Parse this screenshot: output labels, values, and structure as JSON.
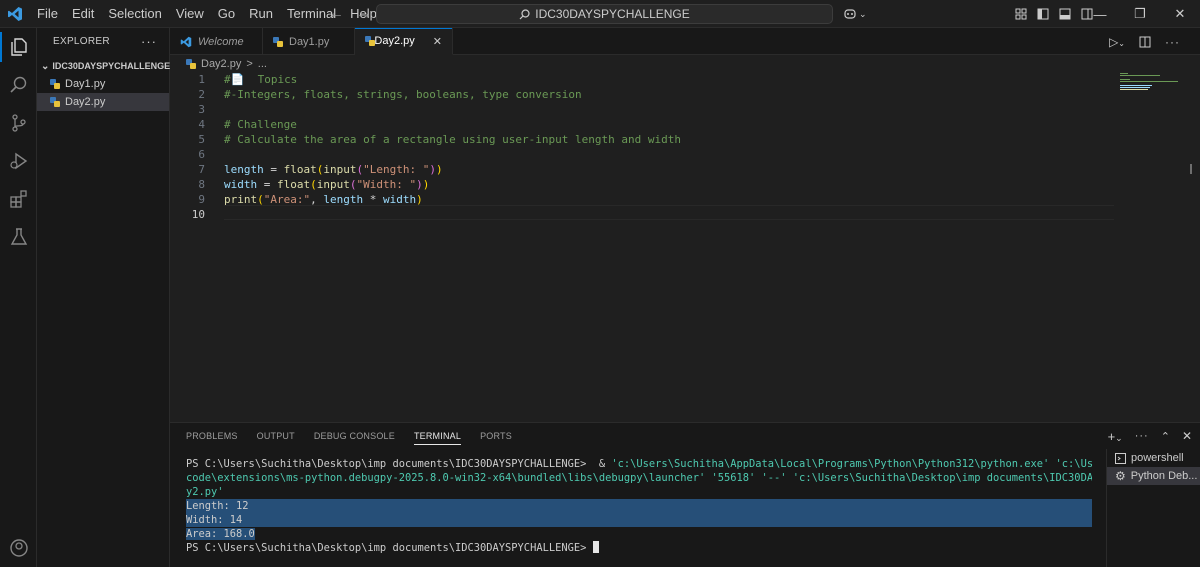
{
  "menu": [
    "File",
    "Edit",
    "Selection",
    "View",
    "Go",
    "Run",
    "Terminal",
    "Help"
  ],
  "command_center": "IDC30DAYSPYCHALLENGE",
  "sidebar": {
    "title": "EXPLORER",
    "folder": "IDC30DAYSPYCHALLENGE",
    "files": [
      {
        "name": "Day1.py"
      },
      {
        "name": "Day2.py"
      }
    ]
  },
  "tabs": [
    {
      "label": "Welcome"
    },
    {
      "label": "Day1.py"
    },
    {
      "label": "Day2.py"
    }
  ],
  "breadcrumb": {
    "file": "Day2.py",
    "sep": ">",
    "rest": "..."
  },
  "editor": {
    "lines": [
      {
        "n": "1",
        "parts": [
          [
            "c-com",
            "#"
          ],
          [
            "c-op",
            "📄"
          ],
          [
            "c-com",
            "  Topics"
          ]
        ]
      },
      {
        "n": "2",
        "parts": [
          [
            "c-com",
            "#-Integers, floats, strings, booleans, type conversion"
          ]
        ]
      },
      {
        "n": "3",
        "parts": []
      },
      {
        "n": "4",
        "parts": [
          [
            "c-com",
            "# Challenge"
          ]
        ]
      },
      {
        "n": "5",
        "parts": [
          [
            "c-com",
            "# Calculate the area of a rectangle using user-input length and width"
          ]
        ]
      },
      {
        "n": "6",
        "parts": []
      },
      {
        "n": "7",
        "parts": [
          [
            "c-var",
            "length"
          ],
          [
            "c-op",
            " = "
          ],
          [
            "c-fn",
            "float"
          ],
          [
            "c-p1",
            "("
          ],
          [
            "c-fn",
            "input"
          ],
          [
            "c-p2",
            "("
          ],
          [
            "c-str",
            "\"Length: \""
          ],
          [
            "c-p2",
            ")"
          ],
          [
            "c-p1",
            ")"
          ]
        ]
      },
      {
        "n": "8",
        "parts": [
          [
            "c-var",
            "width"
          ],
          [
            "c-op",
            " = "
          ],
          [
            "c-fn",
            "float"
          ],
          [
            "c-p1",
            "("
          ],
          [
            "c-fn",
            "input"
          ],
          [
            "c-p2",
            "("
          ],
          [
            "c-str",
            "\"Width: \""
          ],
          [
            "c-p2",
            ")"
          ],
          [
            "c-p1",
            ")"
          ]
        ]
      },
      {
        "n": "9",
        "parts": [
          [
            "c-fn",
            "print"
          ],
          [
            "c-p1",
            "("
          ],
          [
            "c-str",
            "\"Area:\""
          ],
          [
            "c-op",
            ", "
          ],
          [
            "c-var",
            "length"
          ],
          [
            "c-op",
            " * "
          ],
          [
            "c-var",
            "width"
          ],
          [
            "c-p1",
            ")"
          ]
        ]
      },
      {
        "n": "10",
        "parts": []
      }
    ]
  },
  "panel": {
    "tabs": [
      "PROBLEMS",
      "OUTPUT",
      "DEBUG CONSOLE",
      "TERMINAL",
      "PORTS"
    ],
    "active_tab": "TERMINAL",
    "terminal": {
      "cmd_prompt": "PS C:\\Users\\Suchitha\\Desktop\\imp documents\\IDC30DAYSPYCHALLENGE>  & ",
      "cmd_line1_rest": "'c:\\Users\\Suchitha\\AppData\\Local\\Programs\\Python\\Python312\\python.exe' 'c:\\Users\\Suchitha\\.vs",
      "cmd_line2": "code\\extensions\\ms-python.debugpy-2025.8.0-win32-x64\\bundled\\libs\\debugpy\\launcher' '55618' '--' 'c:\\Users\\Suchitha\\Desktop\\imp documents\\IDC30DAYSPYCHALLENGE\\Da",
      "cmd_line3": "y2.py'",
      "out1": "Length: 12",
      "out2": "Width: 14",
      "out3": "Area: 168.0",
      "prompt": "PS C:\\Users\\Suchitha\\Desktop\\imp documents\\IDC30DAYSPYCHALLENGE> "
    },
    "terminal_list": [
      {
        "label": "powershell"
      },
      {
        "label": "Python Deb..."
      }
    ]
  }
}
